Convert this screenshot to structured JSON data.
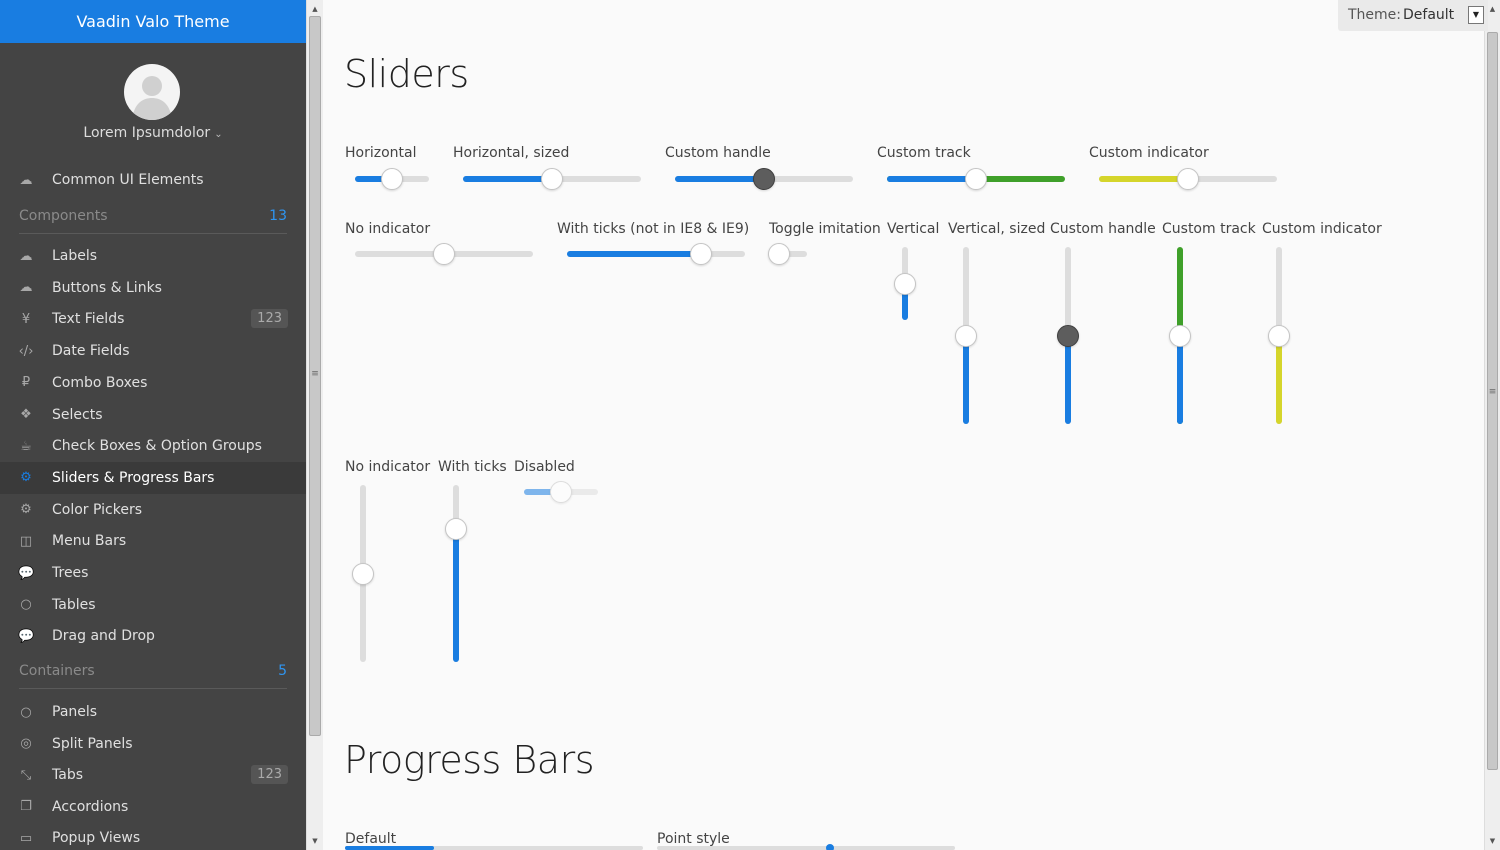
{
  "app": {
    "brand_prefix": "Vaadin",
    "brand_name": "Valo Theme"
  },
  "user": {
    "name": "Lorem Ipsumdolor",
    "avatar_icon": "user-silhouette-icon"
  },
  "nav": {
    "top_item": {
      "label": "Common UI Elements",
      "icon": "cloud-icon"
    },
    "components_header": {
      "label": "Components",
      "count": "13"
    },
    "components": [
      {
        "label": "Labels",
        "icon": "cloud-upload-icon",
        "glyph": "☁"
      },
      {
        "label": "Buttons & Links",
        "icon": "cloud-download-icon",
        "glyph": "☁"
      },
      {
        "label": "Text Fields",
        "icon": "yen-icon",
        "glyph": "¥",
        "badge": "123"
      },
      {
        "label": "Date Fields",
        "icon": "code-icon",
        "glyph": "‹/›"
      },
      {
        "label": "Combo Boxes",
        "icon": "ruble-icon",
        "glyph": "₽"
      },
      {
        "label": "Selects",
        "icon": "codepen-icon",
        "glyph": "❖"
      },
      {
        "label": "Check Boxes & Option Groups",
        "icon": "coffee-icon",
        "glyph": "☕"
      },
      {
        "label": "Sliders & Progress Bars",
        "icon": "gear-icon",
        "glyph": "⚙",
        "active": true
      },
      {
        "label": "Color Pickers",
        "icon": "gears-icon",
        "glyph": "⚙"
      },
      {
        "label": "Menu Bars",
        "icon": "columns-icon",
        "glyph": "◫"
      },
      {
        "label": "Trees",
        "icon": "comment-icon",
        "glyph": "💬"
      },
      {
        "label": "Tables",
        "icon": "comment-outline-icon",
        "glyph": "○"
      },
      {
        "label": "Drag and Drop",
        "icon": "comments-icon",
        "glyph": "💬"
      }
    ],
    "containers_header": {
      "label": "Containers",
      "count": "5"
    },
    "containers": [
      {
        "label": "Panels",
        "icon": "comments-outline-icon",
        "glyph": "○"
      },
      {
        "label": "Split Panels",
        "icon": "compass-icon",
        "glyph": "◎"
      },
      {
        "label": "Tabs",
        "icon": "compress-icon",
        "glyph": "⤡",
        "badge": "123"
      },
      {
        "label": "Accordions",
        "icon": "copy-icon",
        "glyph": "❐"
      },
      {
        "label": "Popup Views",
        "icon": "credit-card-icon",
        "glyph": "▭"
      }
    ]
  },
  "theme_selector": {
    "label": "Theme:",
    "value": "Default"
  },
  "sliders": {
    "title": "Sliders",
    "horizontal": [
      {
        "label": "Horizontal",
        "value": 0.5,
        "fill": "#197de1"
      },
      {
        "label": "Horizontal, sized",
        "value": 0.5,
        "fill": "#197de1"
      },
      {
        "label": "Custom handle",
        "value": 0.5,
        "fill": "#197de1",
        "handle": "dark"
      },
      {
        "label": "Custom track",
        "value": 0.5,
        "fill": "#197de1",
        "track": "#3fa02a"
      },
      {
        "label": "Custom indicator",
        "value": 0.5,
        "fill": "#d5d52b"
      },
      {
        "label": "No indicator",
        "value": 0.5
      },
      {
        "label": "With ticks (not in IE8 & IE9)",
        "value": 0.75,
        "fill": "#197de1"
      },
      {
        "label": "Toggle imitation",
        "value": 0
      },
      {
        "label": "Disabled",
        "value": 0.5,
        "fill": "#197de1",
        "disabled": true
      }
    ],
    "vertical": [
      {
        "label": "Vertical",
        "value": 0.5,
        "fill": "#197de1"
      },
      {
        "label": "Vertical, sized",
        "value": 0.5,
        "fill": "#197de1"
      },
      {
        "label": "Custom handle",
        "value": 0.5,
        "fill": "#197de1",
        "handle": "dark"
      },
      {
        "label": "Custom track",
        "value": 0.5,
        "fill": "#197de1",
        "track": "#3fa02a"
      },
      {
        "label": "Custom indicator",
        "value": 0.5,
        "fill": "#d5d52b"
      },
      {
        "label": "No indicator",
        "value": 0.5
      },
      {
        "label": "With ticks",
        "value": 0.75,
        "fill": "#197de1"
      }
    ]
  },
  "progress": {
    "title": "Progress Bars",
    "bars": [
      {
        "label": "Default",
        "value": 0.3
      },
      {
        "label": "Point style",
        "value": 0.58
      }
    ]
  }
}
